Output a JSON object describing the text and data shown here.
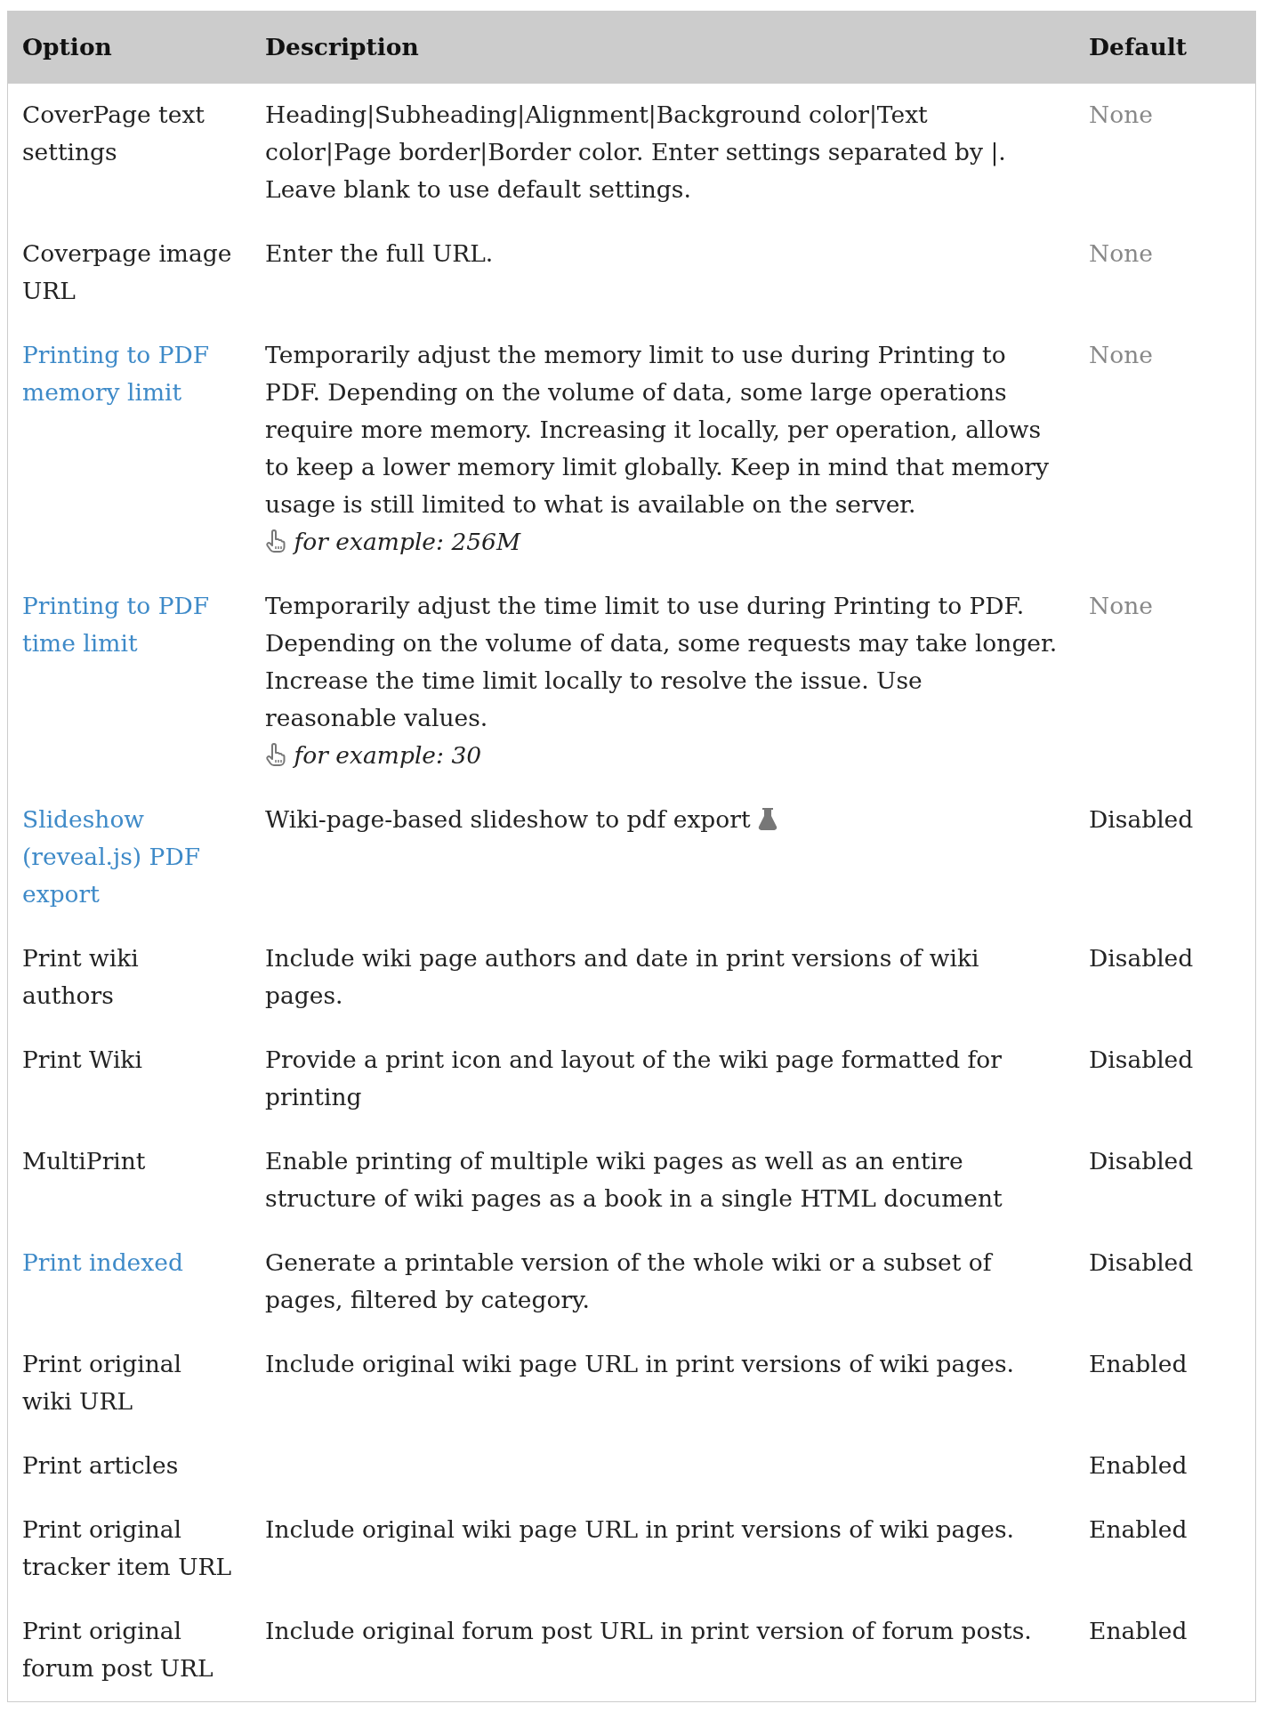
{
  "table": {
    "columns": [
      "Option",
      "Description",
      "Default"
    ],
    "rows": [
      {
        "option": "CoverPage text settings",
        "option_link": false,
        "description": "Heading|Subheading|Alignment|Background color|Text color|Page border|Border color. Enter settings separated by |. Leave blank to use default settings.",
        "default": "None",
        "default_muted": true
      },
      {
        "option": "Coverpage image URL",
        "option_link": false,
        "description": "Enter the full URL.",
        "default": "None",
        "default_muted": true
      },
      {
        "option": "Printing to PDF memory limit",
        "option_link": true,
        "description": "Temporarily adjust the memory limit to use during Printing to PDF. Depending on the volume of data, some large operations require more memory. Increasing it locally, per operation, allows to keep a lower memory limit globally. Keep in mind that memory usage is still limited to what is available on the server.",
        "example": "for example: 256M",
        "default": "None",
        "default_muted": true
      },
      {
        "option": "Printing to PDF time limit",
        "option_link": true,
        "description": "Temporarily adjust the time limit to use during Printing to PDF. Depending on the volume of data, some requests may take longer. Increase the time limit locally to resolve the issue. Use reasonable values.",
        "example": "for example: 30",
        "default": "None",
        "default_muted": true
      },
      {
        "option": "Slideshow (reveal.js) PDF export",
        "option_link": true,
        "description": "Wiki-page-based slideshow to pdf export",
        "experimental": true,
        "default": "Disabled",
        "default_muted": false
      },
      {
        "option": "Print wiki authors",
        "option_link": false,
        "description": "Include wiki page authors and date in print versions of wiki pages.",
        "default": "Disabled",
        "default_muted": false
      },
      {
        "option": "Print Wiki",
        "option_link": false,
        "description": "Provide a print icon and layout of the wiki page formatted for printing",
        "default": "Disabled",
        "default_muted": false
      },
      {
        "option": "MultiPrint",
        "option_link": false,
        "description": "Enable printing of multiple wiki pages as well as an entire structure of wiki pages as a book in a single HTML document",
        "default": "Disabled",
        "default_muted": false
      },
      {
        "option": "Print indexed",
        "option_link": true,
        "description": "Generate a printable version of the whole wiki or a subset of pages, filtered by category.",
        "default": "Disabled",
        "default_muted": false
      },
      {
        "option": "Print original wiki URL",
        "option_link": false,
        "description": "Include original wiki page URL in print versions of wiki pages.",
        "default": "Enabled",
        "default_muted": false
      },
      {
        "option": "Print articles",
        "option_link": false,
        "default": "Enabled",
        "default_muted": false
      },
      {
        "option": "Print original tracker item URL",
        "option_link": false,
        "description": "Include original wiki page URL in print versions of wiki pages.",
        "default": "Enabled",
        "default_muted": false
      },
      {
        "option": "Print original forum post URL",
        "option_link": false,
        "description": "Include original forum post URL in print version of forum posts.",
        "default": "Enabled",
        "default_muted": false
      }
    ]
  }
}
